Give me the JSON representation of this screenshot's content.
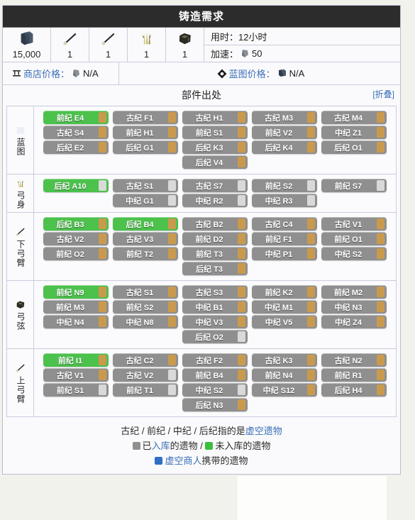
{
  "window": {
    "title": "铸造需求"
  },
  "requirements": {
    "costs": [
      {
        "icon": "credits-icon",
        "value": "15,000"
      },
      {
        "icon": "rod-icon",
        "value": "1"
      },
      {
        "icon": "rod-icon",
        "value": "1"
      },
      {
        "icon": "fiber-icon",
        "value": "1"
      },
      {
        "icon": "component-icon",
        "value": "1"
      }
    ],
    "build_time_label": "用时：",
    "build_time_value": "12小时",
    "rush_label": "加速：",
    "rush_icon": "platinum-icon",
    "rush_value": "50"
  },
  "prices": {
    "shop_icon": "shop-icon",
    "shop_label": "商店价格：",
    "shop_currency_icon": "platinum-icon",
    "shop_value": "N/A",
    "blueprint_icon": "blueprint-icon",
    "blueprint_label": "蓝图价格：",
    "blueprint_currency_icon": "credits-icon",
    "blueprint_value": "N/A"
  },
  "section": {
    "title": "部件出处",
    "collapse_label": "[折叠]"
  },
  "parts": [
    {
      "icon": "blueprint-part-icon",
      "label": "蓝图",
      "rows": [
        [
          {
            "text": "前纪 E4",
            "state": "green",
            "square": "tan"
          },
          {
            "text": "古纪 F1",
            "state": "gray",
            "square": "tan"
          },
          {
            "text": "古纪 H1",
            "state": "gray",
            "square": "tan"
          },
          {
            "text": "古纪 M3",
            "state": "gray",
            "square": "tan"
          },
          {
            "text": "古纪 M4",
            "state": "gray",
            "square": "tan"
          }
        ],
        [
          {
            "text": "古纪 S4",
            "state": "gray",
            "square": "tan"
          },
          {
            "text": "前纪 H1",
            "state": "gray",
            "square": "tan"
          },
          {
            "text": "前纪 S1",
            "state": "gray",
            "square": "tan"
          },
          {
            "text": "前纪 V2",
            "state": "gray",
            "square": "tan"
          },
          {
            "text": "中纪 Z1",
            "state": "gray",
            "square": "tan"
          }
        ],
        [
          {
            "text": "后纪 E2",
            "state": "gray",
            "square": "tan"
          },
          {
            "text": "后纪 G1",
            "state": "gray",
            "square": "tan"
          },
          {
            "text": "后纪 K3",
            "state": "gray",
            "square": "tan"
          },
          {
            "text": "后纪 K4",
            "state": "gray",
            "square": "tan"
          },
          {
            "text": "后纪 O1",
            "state": "gray",
            "square": "tan"
          }
        ],
        [
          {
            "text": "后纪 V4",
            "state": "gray",
            "square": "tan"
          }
        ]
      ]
    },
    {
      "icon": "fiber-icon",
      "label": "弓身",
      "rows": [
        [
          {
            "text": "后纪 A10",
            "state": "green",
            "square": "gray"
          },
          {
            "text": "古纪 S1",
            "state": "gray",
            "square": "gray"
          },
          {
            "text": "古纪 S7",
            "state": "gray",
            "square": "gray"
          },
          {
            "text": "前纪 S2",
            "state": "gray",
            "square": "gray"
          },
          {
            "text": "前纪 S7",
            "state": "gray",
            "square": "gray"
          }
        ],
        [
          {
            "text": "中纪 G1",
            "state": "gray",
            "square": "gray"
          },
          {
            "text": "中纪 R2",
            "state": "gray",
            "square": "gray"
          },
          {
            "text": "中纪 R3",
            "state": "gray",
            "square": "gray"
          }
        ]
      ]
    },
    {
      "icon": "rod-icon",
      "label": "下弓臂",
      "rows": [
        [
          {
            "text": "后纪 B3",
            "state": "green",
            "square": "tan"
          },
          {
            "text": "后纪 B4",
            "state": "green",
            "square": "tan"
          },
          {
            "text": "古纪 B2",
            "state": "gray",
            "square": "tan"
          },
          {
            "text": "古纪 C4",
            "state": "gray",
            "square": "tan"
          },
          {
            "text": "古纪 V1",
            "state": "gray",
            "square": "tan"
          }
        ],
        [
          {
            "text": "古纪 V2",
            "state": "gray",
            "square": "tan"
          },
          {
            "text": "古纪 V3",
            "state": "gray",
            "square": "tan"
          },
          {
            "text": "前纪 D2",
            "state": "gray",
            "square": "tan"
          },
          {
            "text": "前纪 F1",
            "state": "gray",
            "square": "tan"
          },
          {
            "text": "前纪 O1",
            "state": "gray",
            "square": "tan"
          }
        ],
        [
          {
            "text": "前纪 O2",
            "state": "gray",
            "square": "tan"
          },
          {
            "text": "前纪 T2",
            "state": "gray",
            "square": "tan"
          },
          {
            "text": "前纪 T3",
            "state": "gray",
            "square": "tan"
          },
          {
            "text": "中纪 P1",
            "state": "gray",
            "square": "tan"
          },
          {
            "text": "中纪 S2",
            "state": "gray",
            "square": "tan"
          }
        ],
        [
          {
            "text": "后纪 T3",
            "state": "gray",
            "square": "tan"
          }
        ]
      ]
    },
    {
      "icon": "component-icon",
      "label": "弓弦",
      "rows": [
        [
          {
            "text": "前纪 N9",
            "state": "green",
            "square": "tan"
          },
          {
            "text": "古纪 S1",
            "state": "gray",
            "square": "tan"
          },
          {
            "text": "古纪 S3",
            "state": "gray",
            "square": "tan"
          },
          {
            "text": "前纪 K2",
            "state": "gray",
            "square": "tan"
          },
          {
            "text": "前纪 M2",
            "state": "gray",
            "square": "tan"
          }
        ],
        [
          {
            "text": "前纪 M3",
            "state": "gray",
            "square": "tan"
          },
          {
            "text": "前纪 S2",
            "state": "gray",
            "square": "tan"
          },
          {
            "text": "中纪 B1",
            "state": "gray",
            "square": "tan"
          },
          {
            "text": "中纪 M1",
            "state": "gray",
            "square": "tan"
          },
          {
            "text": "中纪 N3",
            "state": "gray",
            "square": "tan"
          }
        ],
        [
          {
            "text": "中纪 N4",
            "state": "gray",
            "square": "tan"
          },
          {
            "text": "中纪 N8",
            "state": "gray",
            "square": "tan"
          },
          {
            "text": "中纪 V3",
            "state": "gray",
            "square": "tan"
          },
          {
            "text": "中纪 V5",
            "state": "gray",
            "square": "tan"
          },
          {
            "text": "中纪 Z4",
            "state": "gray",
            "square": "tan"
          }
        ],
        [
          {
            "text": "后纪 O2",
            "state": "gray",
            "square": "gray"
          }
        ]
      ]
    },
    {
      "icon": "rod-icon",
      "label": "上弓臂",
      "rows": [
        [
          {
            "text": "前纪 I1",
            "state": "green",
            "square": "tan"
          },
          {
            "text": "古纪 C2",
            "state": "gray",
            "square": "tan"
          },
          {
            "text": "古纪 F2",
            "state": "gray",
            "square": "tan"
          },
          {
            "text": "古纪 K3",
            "state": "gray",
            "square": "tan"
          },
          {
            "text": "古纪 N2",
            "state": "gray",
            "square": "tan"
          }
        ],
        [
          {
            "text": "古纪 V1",
            "state": "gray",
            "square": "tan"
          },
          {
            "text": "古纪 V2",
            "state": "gray",
            "square": "gray"
          },
          {
            "text": "前纪 B4",
            "state": "gray",
            "square": "tan"
          },
          {
            "text": "前纪 N4",
            "state": "gray",
            "square": "tan"
          },
          {
            "text": "前纪 R1",
            "state": "gray",
            "square": "tan"
          }
        ],
        [
          {
            "text": "前纪 S1",
            "state": "gray",
            "square": "gray"
          },
          {
            "text": "前纪 T1",
            "state": "gray",
            "square": "gray"
          },
          {
            "text": "中纪 S2",
            "state": "gray",
            "square": "gray"
          },
          {
            "text": "中纪 S12",
            "state": "gray",
            "square": "tan"
          },
          {
            "text": "后纪 H4",
            "state": "gray",
            "square": "tan"
          }
        ],
        [
          {
            "text": "后纪 N3",
            "state": "gray",
            "square": "tan"
          }
        ]
      ]
    }
  ],
  "legend": {
    "line1_prefix": "古纪 / 前纪 / 中纪 / 后纪指的是",
    "line1_link": "虚空遗物",
    "line2_a": "已",
    "line2_a_link": "入库",
    "line2_b": "的遗物 / ",
    "line2_c": "未入库的遗物",
    "line3_link": "虚空商人",
    "line3_text": "携带的遗物"
  },
  "colors": {
    "title_bar": "#2c2c2c",
    "pill_gray": "#8f8f8f",
    "pill_green": "#4cc14c",
    "square_tan": "#c99a4e",
    "square_gray": "#d9d9d9",
    "link": "#3b6fb6"
  }
}
